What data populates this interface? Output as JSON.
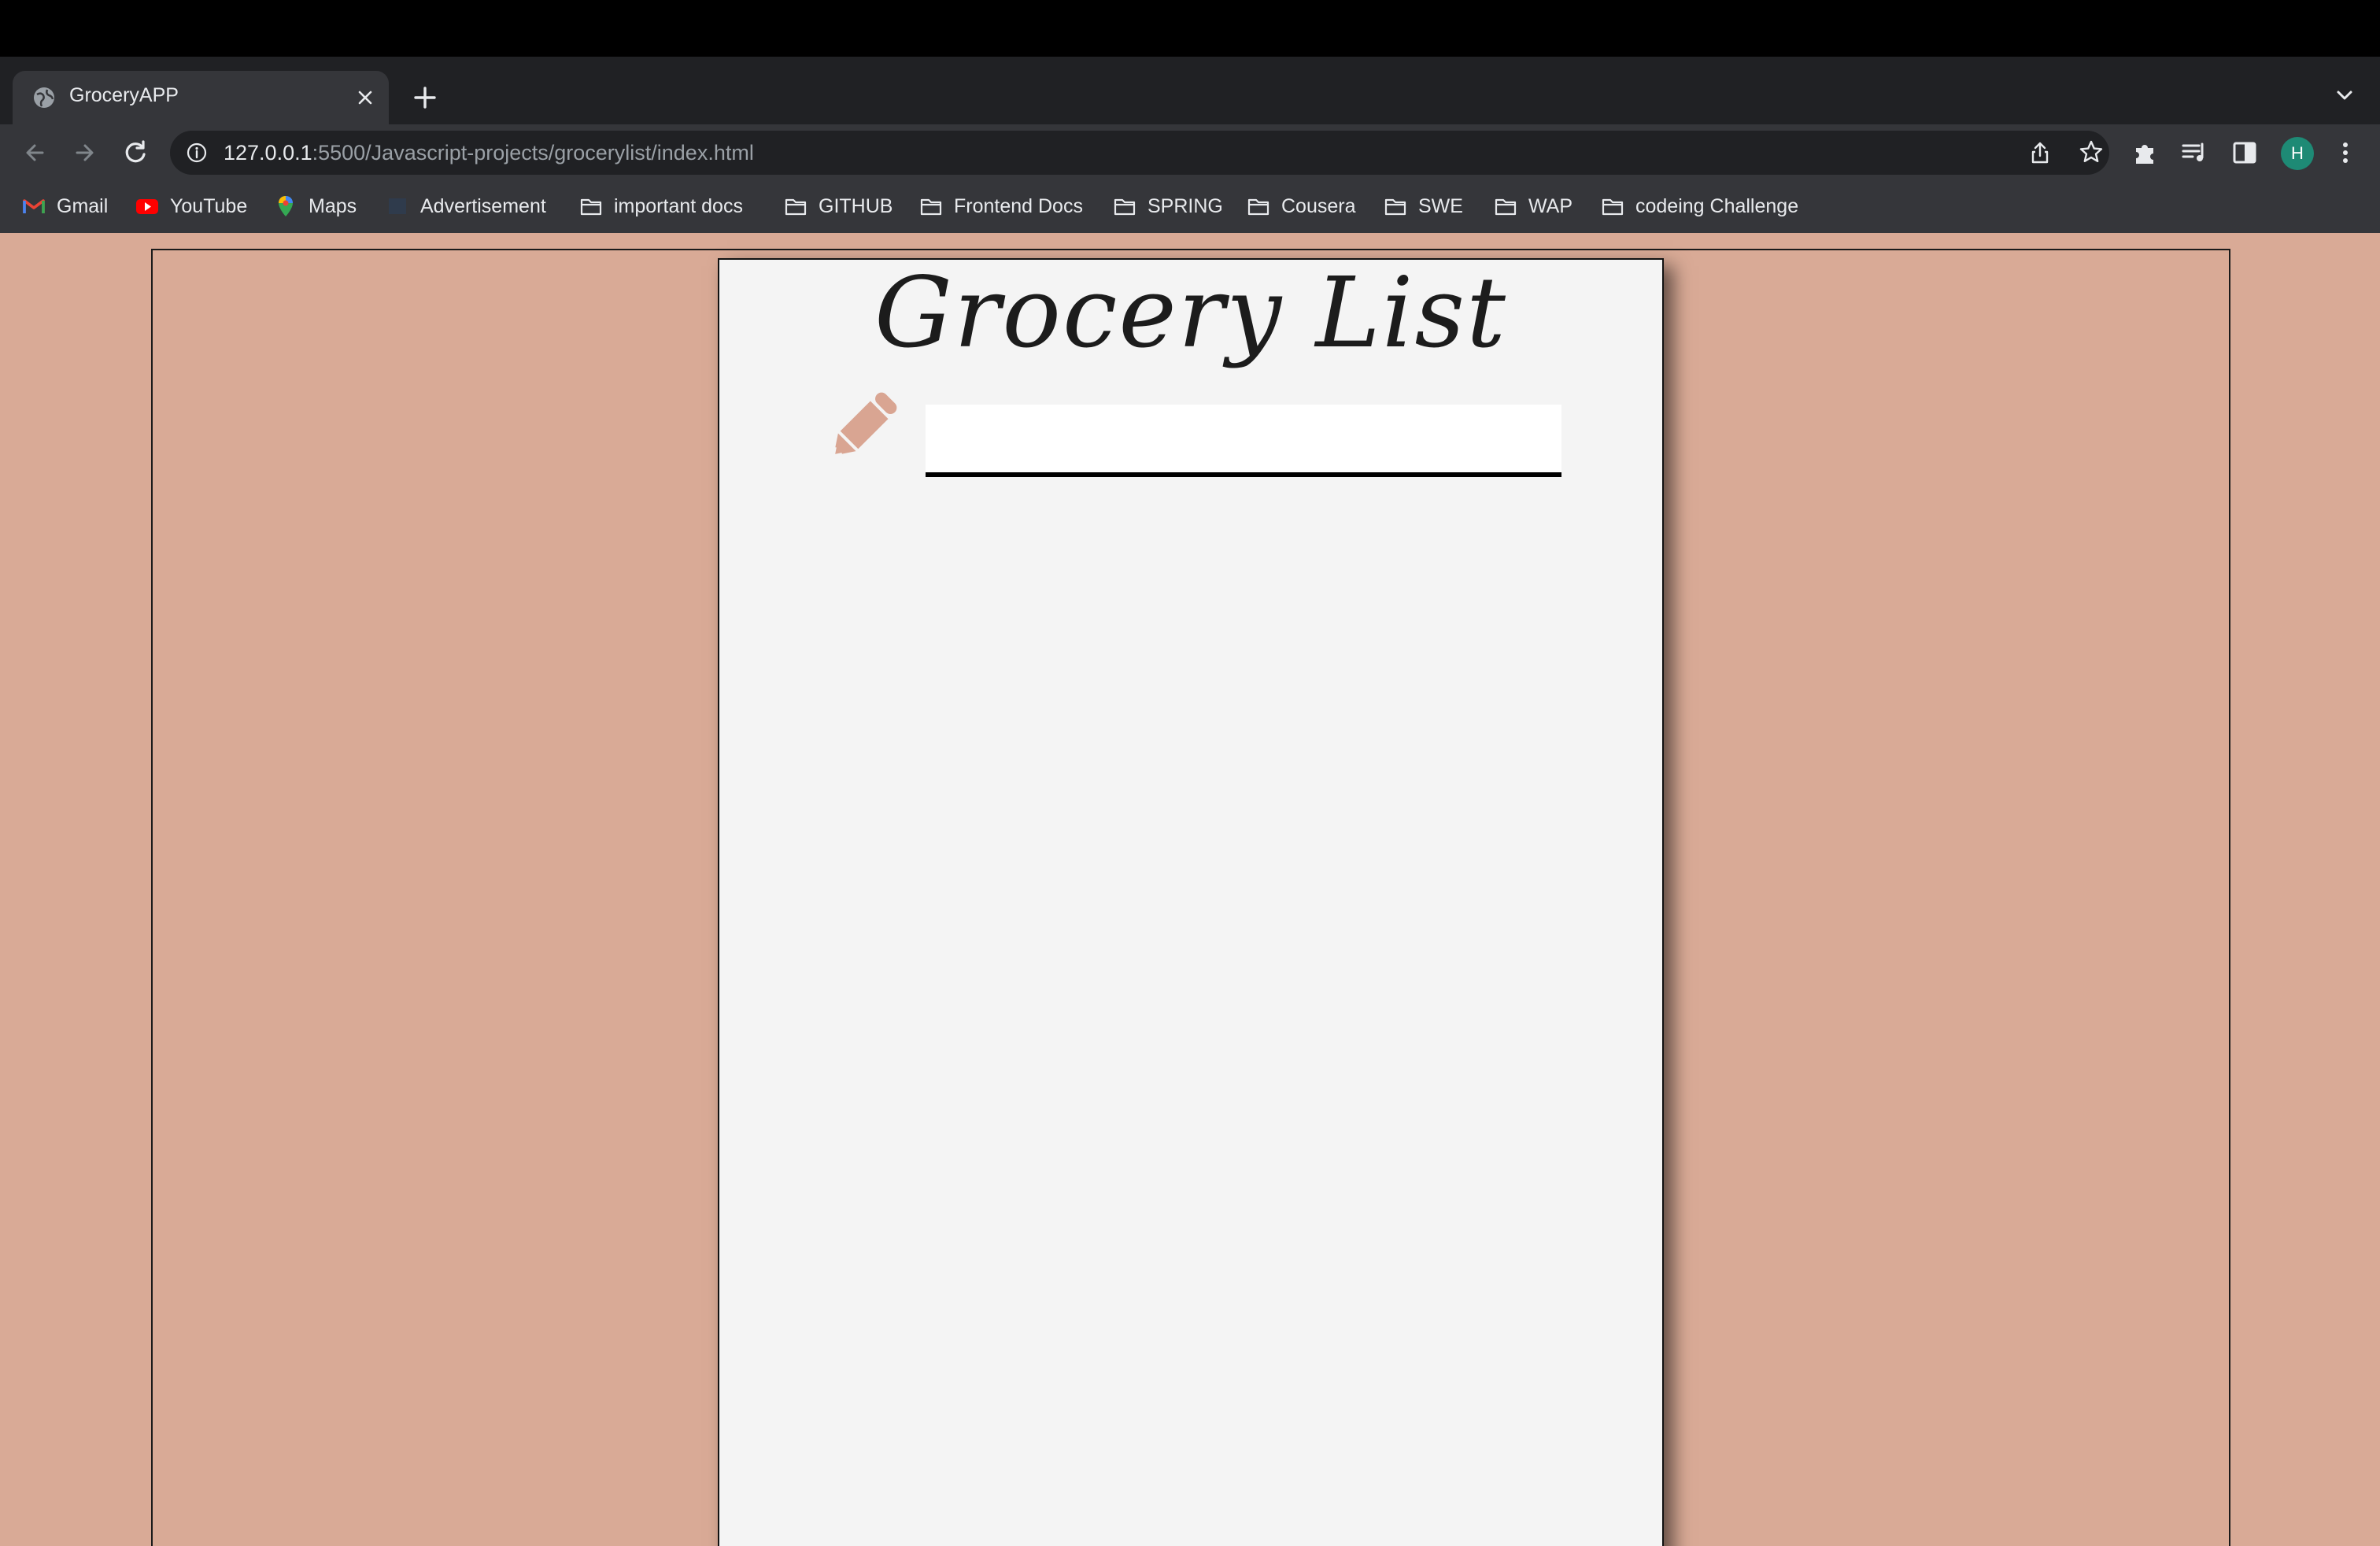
{
  "browser": {
    "tab": {
      "title": "GroceryAPP"
    },
    "address": {
      "host": "127.0.0.1",
      "path": ":5500/Javascript-projects/grocerylist/index.html"
    },
    "profile": {
      "initial": "H",
      "color": "#1e8a75"
    },
    "bookmarks": [
      {
        "label": "Gmail",
        "icon": "gmail-icon"
      },
      {
        "label": "YouTube",
        "icon": "youtube-icon"
      },
      {
        "label": "Maps",
        "icon": "maps-icon"
      },
      {
        "label": "Advertisement",
        "icon": "page-icon"
      },
      {
        "label": "important docs",
        "icon": "folder-icon"
      },
      {
        "label": "GITHUB",
        "icon": "folder-icon"
      },
      {
        "label": "Frontend Docs",
        "icon": "folder-icon"
      },
      {
        "label": "SPRING",
        "icon": "folder-icon"
      },
      {
        "label": "Cousera",
        "icon": "folder-icon"
      },
      {
        "label": "SWE",
        "icon": "folder-icon"
      },
      {
        "label": "WAP",
        "icon": "folder-icon"
      },
      {
        "label": "codeing Challenge",
        "icon": "folder-icon"
      }
    ]
  },
  "app": {
    "title": "Grocery List",
    "input": {
      "value": "",
      "placeholder": ""
    },
    "colors": {
      "background": "#d9aa96",
      "paper": "#f4f4f4",
      "pencil": "#d9a592"
    }
  }
}
